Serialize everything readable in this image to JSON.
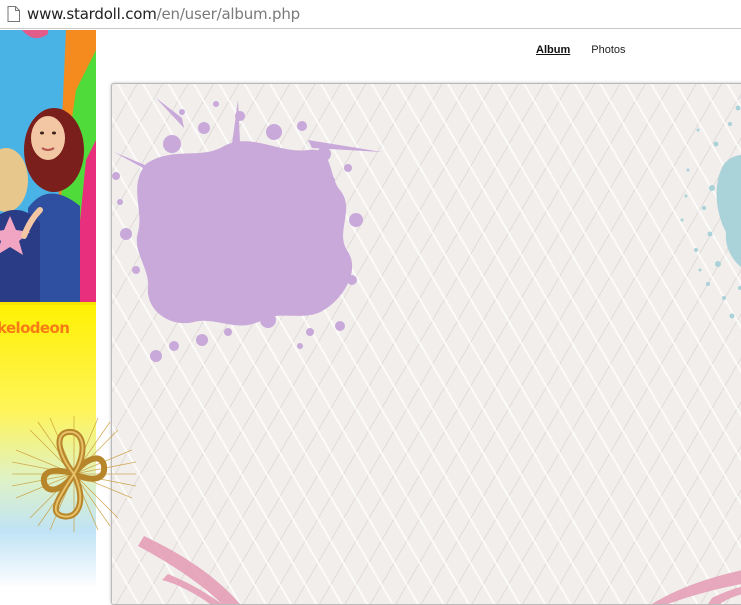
{
  "browser": {
    "url_host": "www.stardoll.com",
    "url_path": "/en/user/album.php",
    "page_icon": "page-icon"
  },
  "banner": {
    "logo_text": "kelodeon"
  },
  "album_nav": {
    "tabs": [
      {
        "label": "Album",
        "active": true
      },
      {
        "label": "Photos",
        "active": false
      }
    ]
  },
  "colors": {
    "purple_splash": "#c9a9d9",
    "teal_splash": "#a9d2d9",
    "pink_splash": "#e59ab4",
    "banner_blue": "#4ab3e6",
    "banner_yellow": "#fff100",
    "logo_orange": "#f77b14",
    "gold": "#c99a34"
  }
}
